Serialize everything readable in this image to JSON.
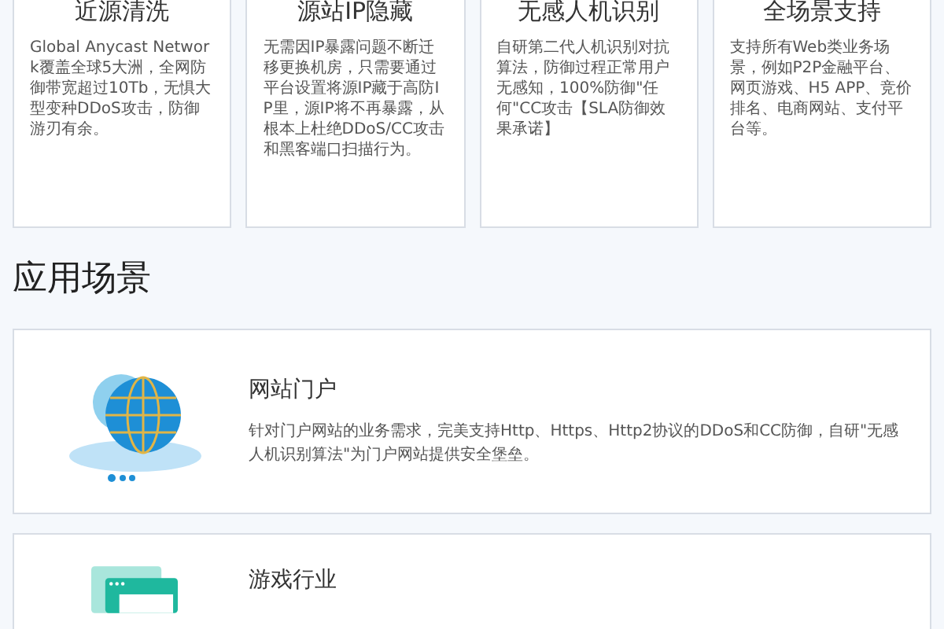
{
  "features": [
    {
      "title": "近源清洗",
      "text": "Global Anycast Network覆盖全球5大洲，全网防御带宽超过10Tb，无惧大型变种DDoS攻击，防御游刃有余。"
    },
    {
      "title": "源站IP隐藏",
      "text": "无需因IP暴露问题不断迁移更换机房，只需要通过平台设置将源IP藏于高防IP里，源IP将不再暴露，从根本上杜绝DDoS/CC攻击和黑客端口扫描行为。"
    },
    {
      "title": "无感人机识别",
      "text": "自研第二代人机识别对抗算法，防御过程正常用户无感知，100%防御\"任何\"CC攻击【SLA防御效果承诺】"
    },
    {
      "title": "全场景支持",
      "text": "支持所有Web类业务场景，例如P2P金融平台、网页游戏、H5 APP、竞价排名、电商网站、支付平台等。"
    }
  ],
  "section": {
    "title": "应用场景"
  },
  "scenarios": [
    {
      "kind": "globe",
      "title": "网站门户",
      "text": "针对门户网站的业务需求，完美支持Http、Https、Http2协议的DDoS和CC防御，自研\"无感人机识别算法\"为门户网站提供安全堡垒。"
    },
    {
      "kind": "window",
      "title": "游戏行业"
    }
  ]
}
